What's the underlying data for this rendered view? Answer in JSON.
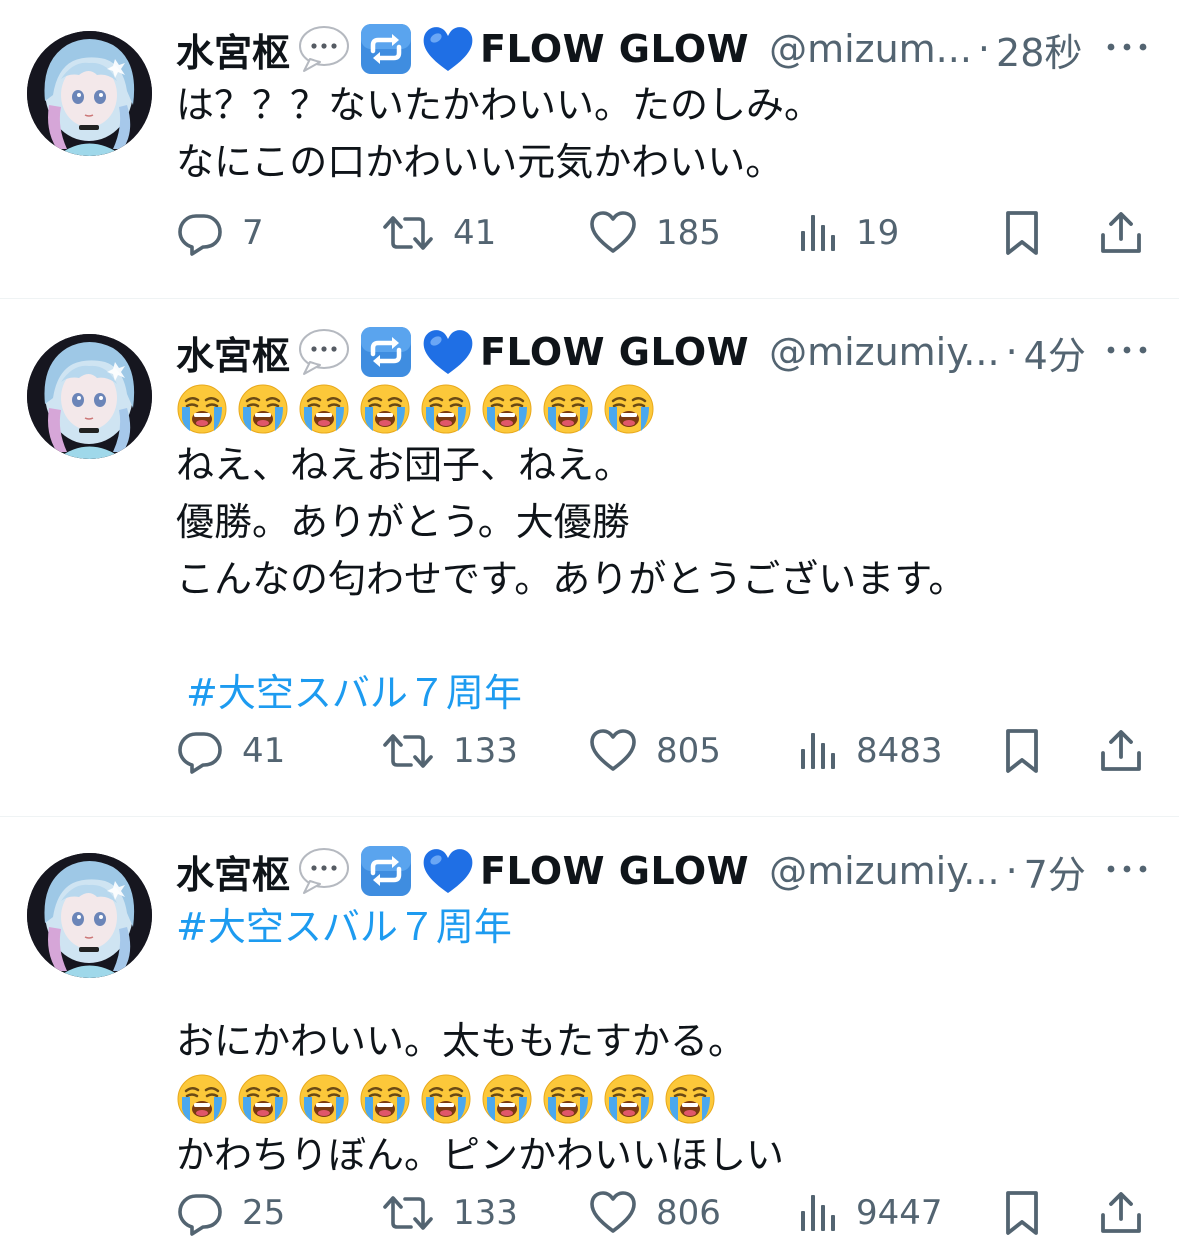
{
  "tweets": [
    {
      "name": "水宮枢",
      "display_suffix": "FLOW GLOW",
      "handle": "@mizum...",
      "separator": "·",
      "time": "28秒",
      "lines": [
        "は？？？ないたかわいい。たのしみ。",
        "なにこの口かわいい元気かわいい。"
      ],
      "stats": {
        "replies": "7",
        "retweets": "41",
        "likes": "185",
        "views": "19"
      }
    },
    {
      "name": "水宮枢",
      "display_suffix": "FLOW GLOW",
      "handle": "@mizumiy...",
      "separator": "·",
      "time": "4分",
      "emoji_count": 8,
      "lines": [
        "ねえ、ねえお団子、ねえ。",
        "優勝。ありがとう。大優勝",
        "こんなの匂わせです。ありがとうございます。"
      ],
      "hashtag": "#大空スバル７周年",
      "stats": {
        "replies": "41",
        "retweets": "133",
        "likes": "805",
        "views": "8483"
      }
    },
    {
      "name": "水宮枢",
      "display_suffix": "FLOW GLOW",
      "handle": "@mizumiy...",
      "separator": "·",
      "time": "7分",
      "hashtag": "#大空スバル７周年",
      "lines": [
        "おにかわいい。太ももたすかる。",
        "かわちりぼん。ピンかわいいほしい"
      ],
      "emoji_count": 9,
      "stats": {
        "replies": "25",
        "retweets": "133",
        "likes": "806",
        "views": "9447"
      }
    }
  ],
  "icons": {
    "name_badges": [
      "speech-bubble-emoji",
      "repeat-button-emoji",
      "blue-heart-emoji"
    ],
    "body_emoji": "loudly-crying-face-emoji",
    "actions": [
      "reply-icon",
      "retweet-icon",
      "like-icon",
      "views-icon",
      "bookmark-icon",
      "share-icon"
    ],
    "more": "more-options-icon"
  },
  "colors": {
    "text": "#0f1419",
    "secondary": "#536471",
    "hashtag": "#1d9bf0",
    "divider": "#eff3f4"
  }
}
